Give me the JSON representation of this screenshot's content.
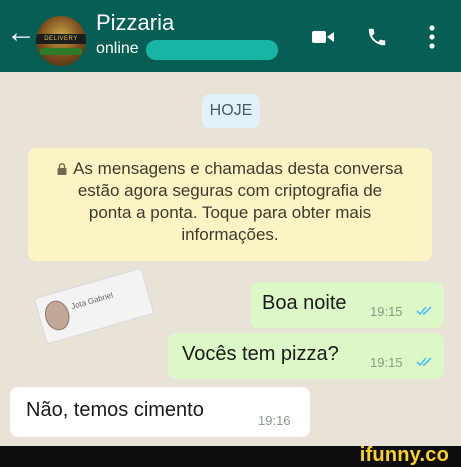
{
  "header": {
    "contact_name": "Pizzaria",
    "status": "online",
    "avatar_text": "DELIVERY"
  },
  "chat": {
    "date_chip": "HOJE",
    "encryption_notice_lines": [
      "As mensagens e chamadas desta conversa",
      "estão agora seguras com criptografia de",
      "ponta a ponta. Toque para obter mais",
      "informações."
    ],
    "messages": [
      {
        "direction": "outgoing",
        "text": "Boa noite",
        "time": "19:15",
        "status": "read"
      },
      {
        "direction": "outgoing",
        "text": "Vocês tem pizza?",
        "time": "19:15",
        "status": "read"
      },
      {
        "direction": "incoming",
        "text": "Não, temos cimento",
        "time": "19:16"
      }
    ],
    "sticker_label": "Jota Gabriel"
  },
  "watermark": {
    "text": "ifunny.co"
  },
  "colors": {
    "header_bg": "#075e54",
    "outgoing_bubble": "#dcf8c6",
    "incoming_bubble": "#ffffff",
    "notice_bg": "#fcf4c4",
    "read_ticks": "#4fc3f7",
    "watermark": "#ffd21f"
  },
  "icons": [
    "back-arrow-icon",
    "video-call-icon",
    "phone-icon",
    "more-vert-icon",
    "lock-icon",
    "read-ticks-icon"
  ]
}
